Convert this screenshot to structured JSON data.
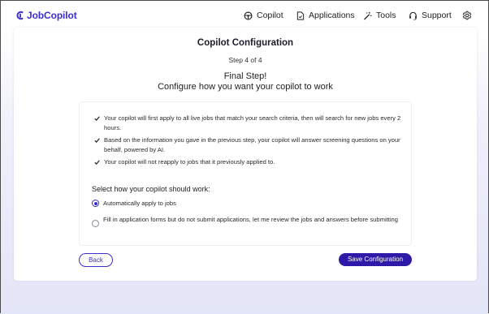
{
  "app": {
    "logo_text": "JobCopilot",
    "brand_color": "#3b2fd0"
  },
  "nav": {
    "copilot": {
      "label": "Copilot",
      "icon": "steering-wheel-icon"
    },
    "applications": {
      "label": "Applications",
      "icon": "document-icon"
    },
    "tools": {
      "label": "Tools",
      "icon": "magic-wand-icon"
    },
    "support": {
      "label": "Support",
      "icon": "headset-icon"
    },
    "settings": {
      "icon": "gear-icon"
    }
  },
  "page": {
    "title": "Copilot Configuration",
    "step": "Step 4 of 4",
    "heading_line1": "Final Step!",
    "heading_line2": "Configure how you want your copilot to work"
  },
  "info_items": [
    "Your copilot will first apply to all live jobs that match your search criteria, then will search for new jobs every 2 hours.",
    "Based on the information you gave in the previous step, your copilot will answer screening questions on your behalf, powered by AI.",
    "Your copilot will not reapply to jobs that it previously applied to."
  ],
  "mode_select": {
    "label": "Select how your copilot should work:",
    "options": [
      {
        "label": "Automatically apply to jobs",
        "selected": true
      },
      {
        "label": "Fill in application forms but do not submit applications, let me review the jobs and answers before submitting",
        "selected": false
      }
    ]
  },
  "actions": {
    "back_label": "Back",
    "save_label": "Save Configuration",
    "save_color": "#2e1aa8"
  }
}
